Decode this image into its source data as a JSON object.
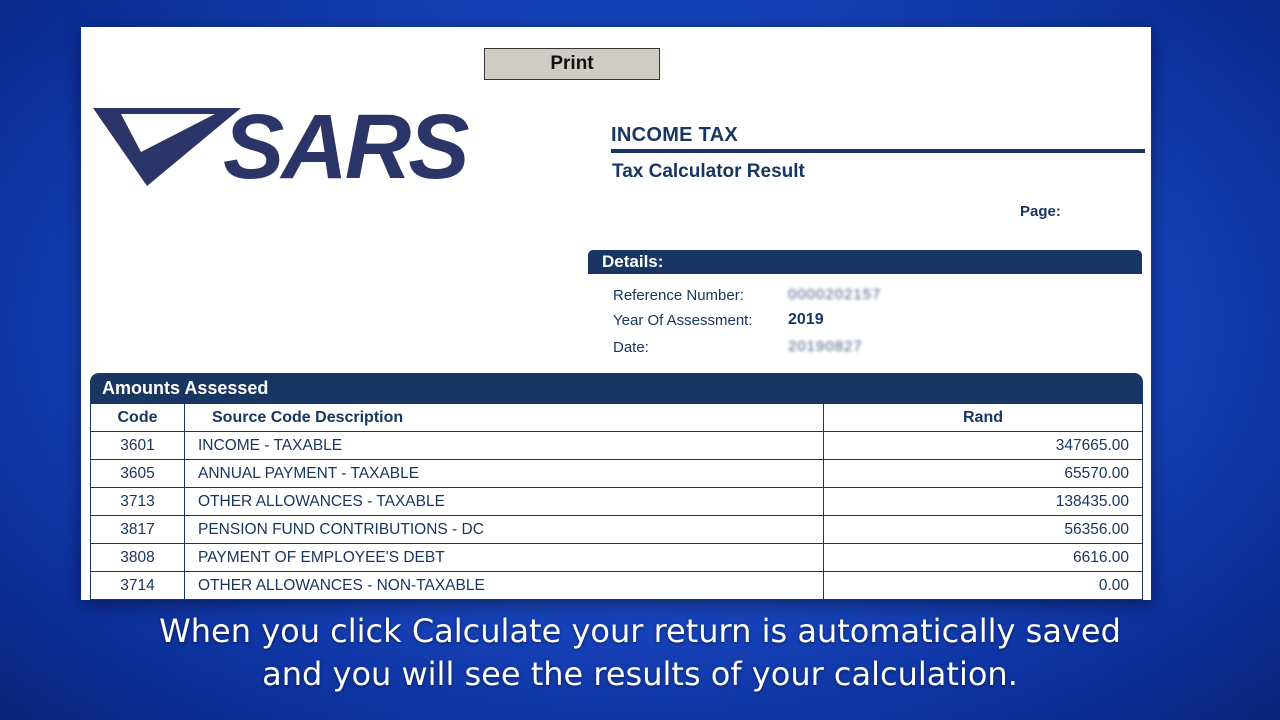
{
  "toolbar": {
    "print_label": "Print"
  },
  "header": {
    "logo_text": "SARS",
    "title": "INCOME TAX",
    "subtitle": "Tax Calculator Result",
    "page_label": "Page:"
  },
  "details": {
    "heading": "Details:",
    "reference_label": "Reference Number:",
    "reference_value": "0000202157",
    "year_label": "Year Of Assessment:",
    "year_value": "2019",
    "date_label": "Date:",
    "date_value": "20190827"
  },
  "amounts": {
    "heading": "Amounts Assessed",
    "columns": [
      "Code",
      "Source Code Description",
      "Rand"
    ],
    "rows": [
      {
        "code": "3601",
        "description": "INCOME - TAXABLE",
        "rand": "347665.00"
      },
      {
        "code": "3605",
        "description": "ANNUAL PAYMENT - TAXABLE",
        "rand": "65570.00"
      },
      {
        "code": "3713",
        "description": "OTHER ALLOWANCES - TAXABLE",
        "rand": "138435.00"
      },
      {
        "code": "3817",
        "description": "PENSION FUND CONTRIBUTIONS - DC",
        "rand": "56356.00"
      },
      {
        "code": "3808",
        "description": "PAYMENT OF EMPLOYEE'S DEBT",
        "rand": "6616.00"
      },
      {
        "code": "3714",
        "description": "OTHER ALLOWANCES - NON-TAXABLE",
        "rand": "0.00"
      }
    ]
  },
  "caption": {
    "line1": "When you click Calculate your return is automatically saved",
    "line2": "and you will see the results of your calculation."
  },
  "colors": {
    "navy": "#183661",
    "background_blue": "#1a49c4"
  }
}
